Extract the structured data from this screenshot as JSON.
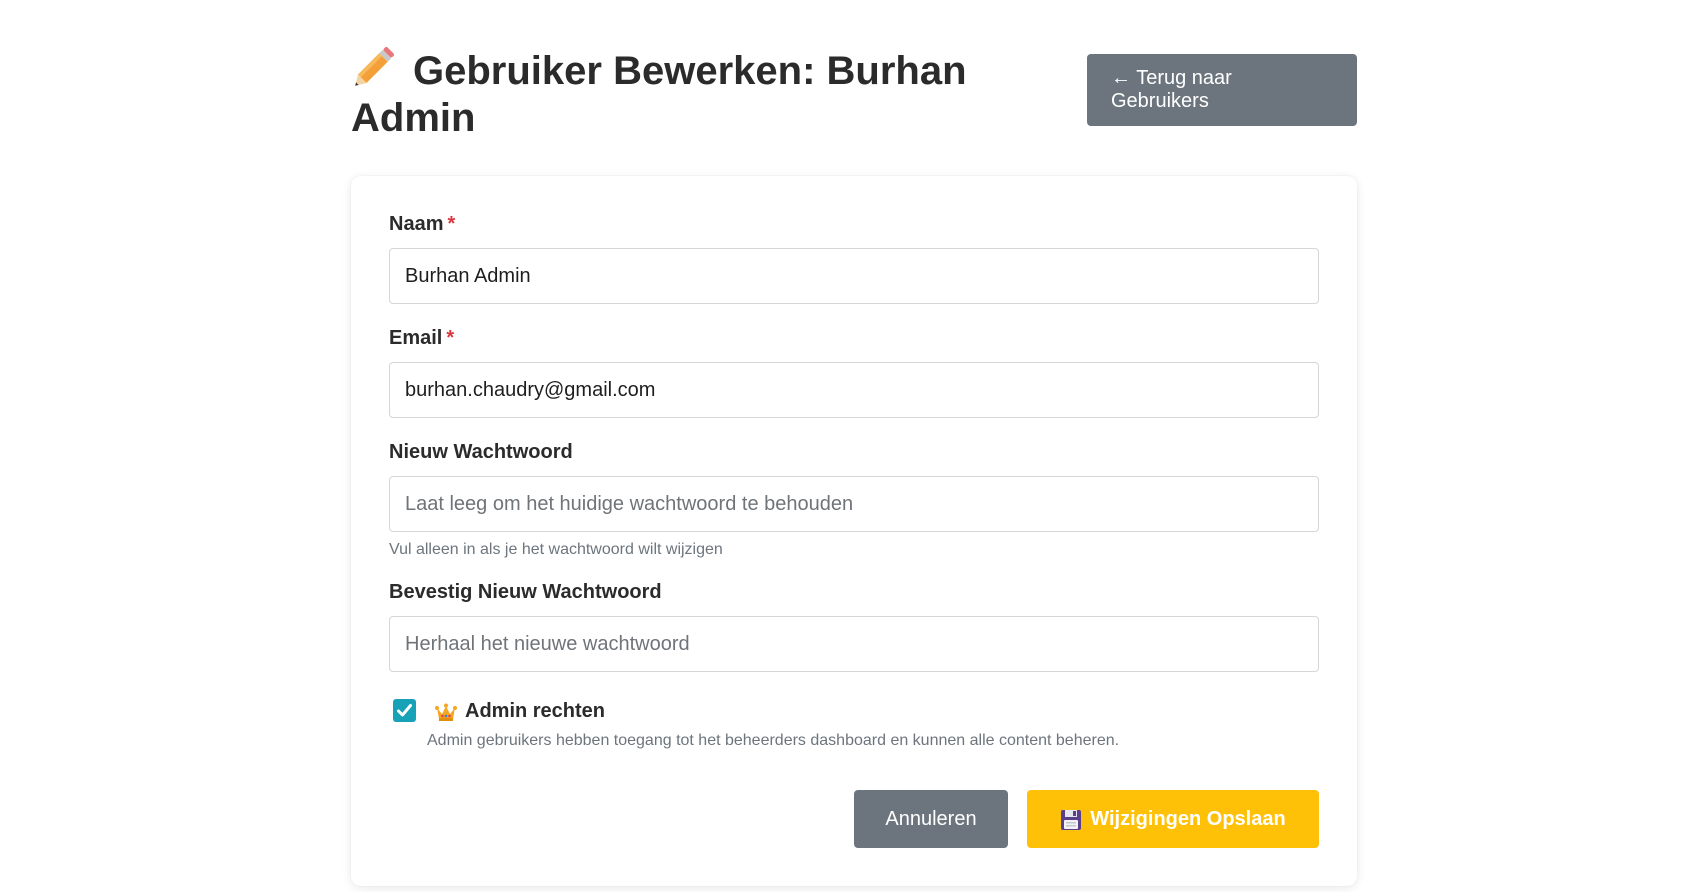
{
  "header": {
    "title": "Gebruiker Bewerken: Burhan Admin",
    "title_icon": "pencil-icon",
    "back_button": "← Terug naar Gebruikers"
  },
  "form": {
    "name": {
      "label": "Naam",
      "required_mark": "*",
      "value": "Burhan Admin"
    },
    "email": {
      "label": "Email",
      "required_mark": "*",
      "value": "burhan.chaudry@gmail.com"
    },
    "new_password": {
      "label": "Nieuw Wachtwoord",
      "value": "",
      "placeholder": "Laat leeg om het huidige wachtwoord te behouden",
      "help": "Vul alleen in als je het wachtwoord wilt wijzigen"
    },
    "confirm_password": {
      "label": "Bevestig Nieuw Wachtwoord",
      "value": "",
      "placeholder": "Herhaal het nieuwe wachtwoord"
    },
    "admin": {
      "checked": true,
      "icon": "crown-icon",
      "label": "Admin rechten",
      "help": "Admin gebruikers hebben toegang tot het beheerders dashboard en kunnen alle content beheren."
    }
  },
  "actions": {
    "cancel_label": "Annuleren",
    "save_icon": "floppy-disk-icon",
    "save_label": "Wijzigingen Opslaan"
  },
  "colors": {
    "secondary": "#6c757d",
    "warning": "#ffc107",
    "checkbox": "#17a2b8",
    "required": "#d9363e"
  }
}
